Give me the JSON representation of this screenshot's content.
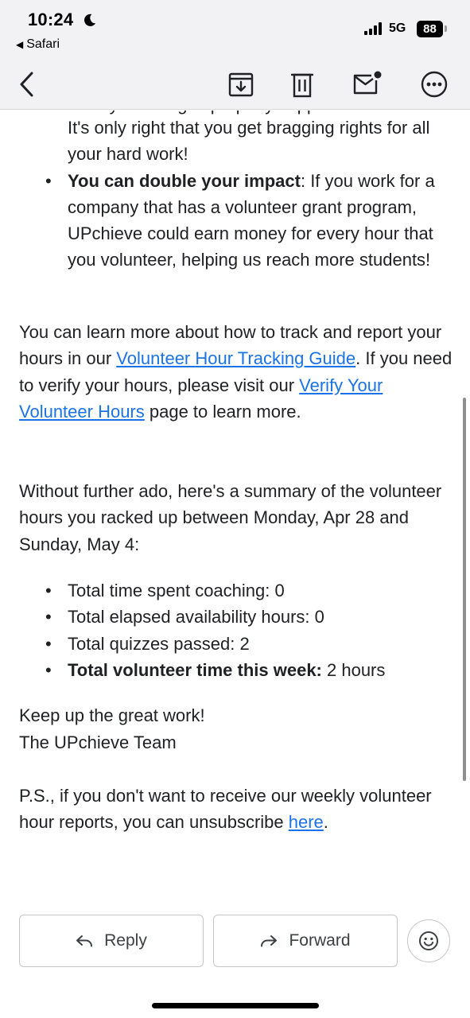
{
  "status_bar": {
    "time": "10:24",
    "back_app": "Safari",
    "network": "5G",
    "battery": "88"
  },
  "toolbar": {
    "icons": [
      "back-chevron-icon",
      "archive-icon",
      "trash-icon",
      "mark-unread-icon",
      "more-icon"
    ]
  },
  "email": {
    "cutoff_line": "Earn your badges properly supported",
    "bullet_top_continuation": "It's only right that you get bragging rights for all your hard work!",
    "bullet_impact_bold": "You can double your impact",
    "bullet_impact_text": ": If you work for a company that has a volunteer grant program, UPchieve could earn money for every hour that you volunteer, helping us reach more students!",
    "para1_before": "You can learn more about how to track and report your hours in our ",
    "para1_link1": "Volunteer Hour Tracking Guide",
    "para1_middle": ". If you need to verify your hours, please visit our ",
    "para1_link2": "Verify Your Volunteer Hours",
    "para1_after": " page to learn more.",
    "para2": "Without further ado, here's a summary of the volunteer hours you racked up between Monday, Apr 28 and Sunday, May 4:",
    "summary": {
      "coaching": "Total time spent coaching: 0",
      "availability": "Total elapsed availability hours: 0",
      "quizzes": "Total quizzes passed: 2",
      "total_bold": "Total volunteer time this week:",
      "total_value": " 2 hours"
    },
    "signoff_line1": "Keep up the great work!",
    "signoff_line2": "The UPchieve Team",
    "ps_text": "P.S., if you don't want to receive our weekly volunteer hour reports, you can unsubscribe ",
    "ps_link": "here",
    "ps_end": "."
  },
  "actions": {
    "reply_label": "Reply",
    "forward_label": "Forward"
  },
  "colors": {
    "link": "#1a73e8",
    "toolbar_bg": "#f2f2f4"
  }
}
